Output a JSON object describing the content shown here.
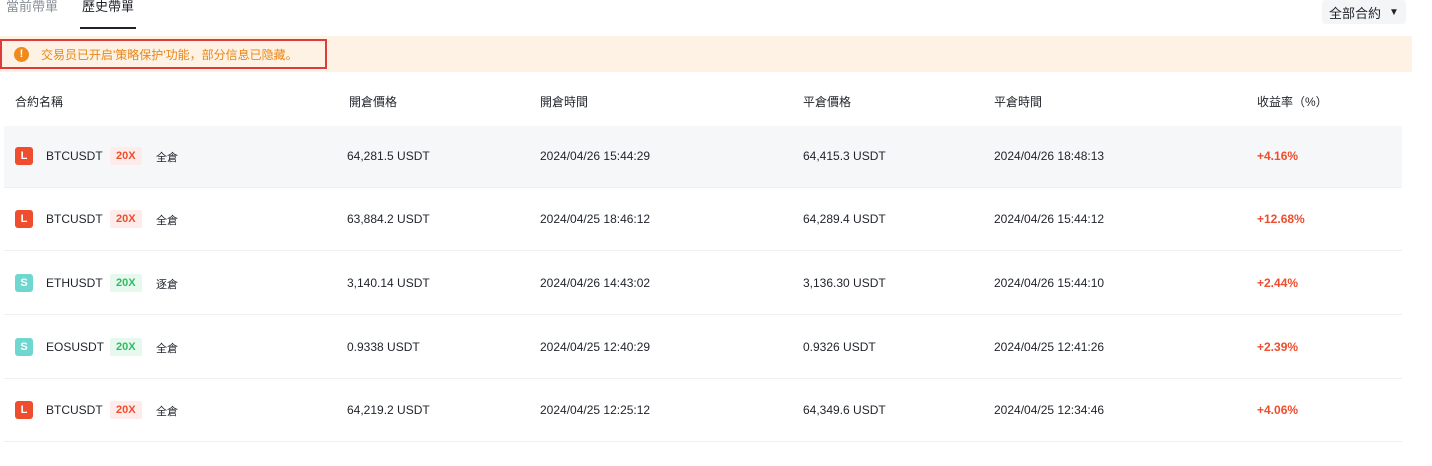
{
  "tabs": {
    "current": "當前帶單",
    "history": "歷史帶單"
  },
  "filter": {
    "label": "全部合約"
  },
  "notice": {
    "text": "交易员已开启'策略保护'功能，部分信息已隐藏。"
  },
  "columns": {
    "symbol": "合約名稱",
    "open_price": "開倉價格",
    "open_time": "開倉時間",
    "close_price": "平倉價格",
    "close_time": "平倉時間",
    "pnl": "收益率（%）"
  },
  "rows": [
    {
      "side": "L",
      "symbol": "BTCUSDT",
      "leverage": "20X",
      "mode": "全倉",
      "open_price": "64,281.5 USDT",
      "open_time": "2024/04/26 15:44:29",
      "close_price": "64,415.3 USDT",
      "close_time": "2024/04/26 18:48:13",
      "pnl": "+4.16%"
    },
    {
      "side": "L",
      "symbol": "BTCUSDT",
      "leverage": "20X",
      "mode": "全倉",
      "open_price": "63,884.2 USDT",
      "open_time": "2024/04/25 18:46:12",
      "close_price": "64,289.4 USDT",
      "close_time": "2024/04/26 15:44:12",
      "pnl": "+12.68%"
    },
    {
      "side": "S",
      "symbol": "ETHUSDT",
      "leverage": "20X",
      "mode": "逐倉",
      "open_price": "3,140.14 USDT",
      "open_time": "2024/04/26 14:43:02",
      "close_price": "3,136.30 USDT",
      "close_time": "2024/04/26 15:44:10",
      "pnl": "+2.44%"
    },
    {
      "side": "S",
      "symbol": "EOSUSDT",
      "leverage": "20X",
      "mode": "全倉",
      "open_price": "0.9338 USDT",
      "open_time": "2024/04/25 12:40:29",
      "close_price": "0.9326 USDT",
      "close_time": "2024/04/25 12:41:26",
      "pnl": "+2.39%"
    },
    {
      "side": "L",
      "symbol": "BTCUSDT",
      "leverage": "20X",
      "mode": "全倉",
      "open_price": "64,219.2 USDT",
      "open_time": "2024/04/25 12:25:12",
      "close_price": "64,349.6 USDT",
      "close_time": "2024/04/25 12:34:46",
      "pnl": "+4.06%"
    }
  ],
  "colors": {
    "long": "#ee4d2e",
    "short": "#6fd6d0",
    "notice_text": "#e8861a"
  }
}
